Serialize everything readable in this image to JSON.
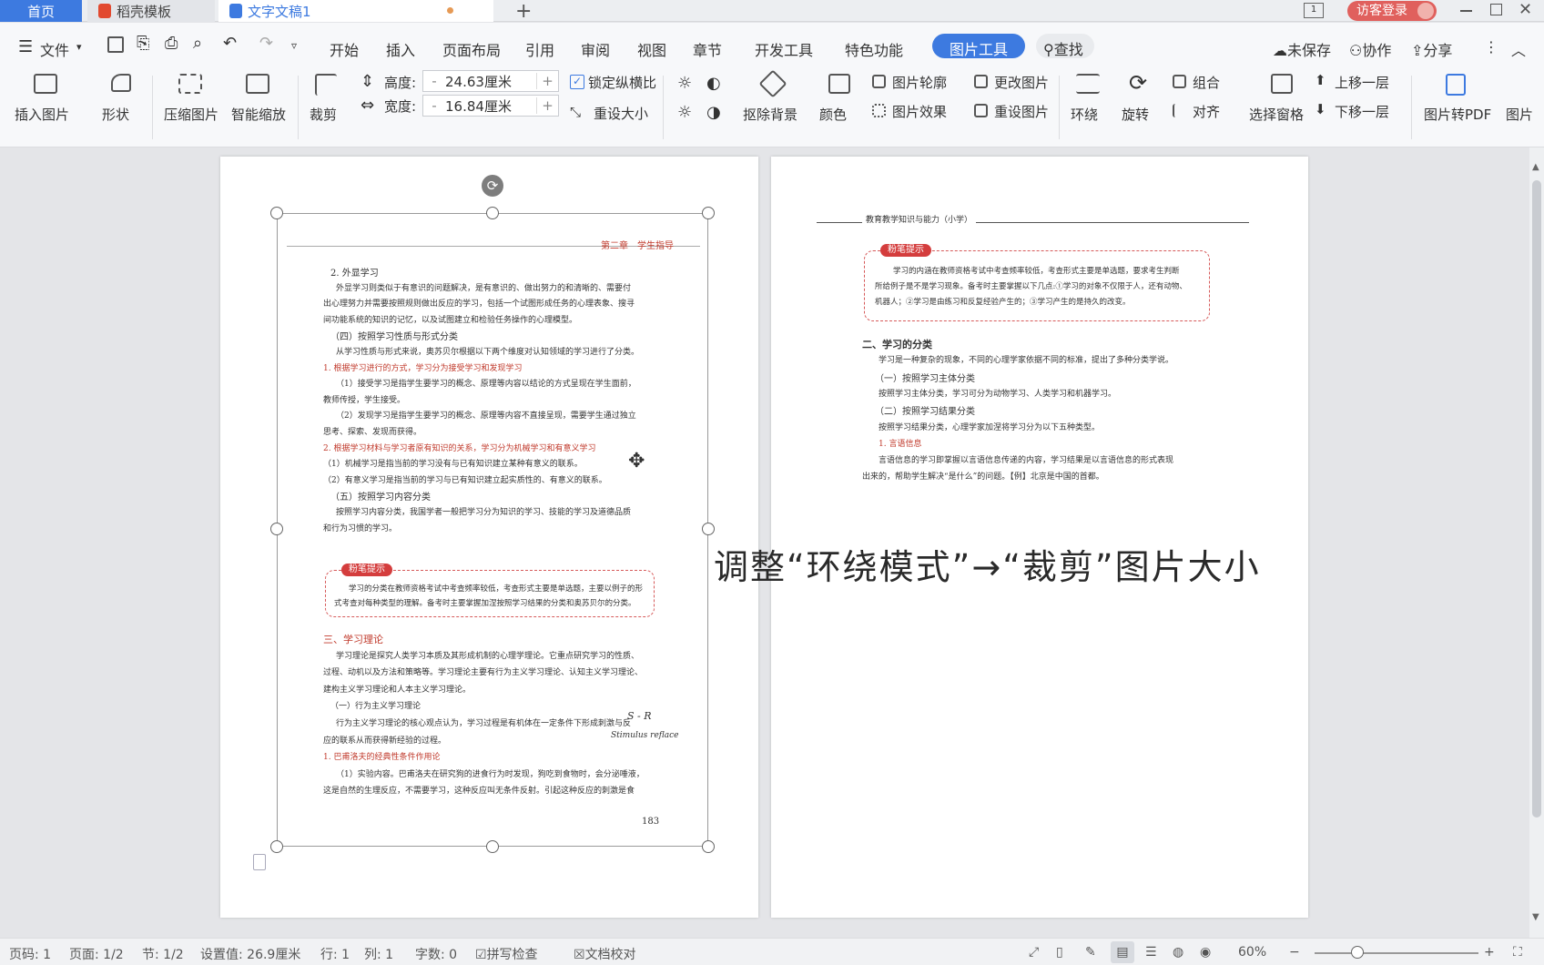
{
  "tabs": {
    "home": "首页",
    "template": "稻壳模板",
    "doc": "文字文稿1",
    "add": "+",
    "login": "访客登录"
  },
  "menu": {
    "file": "文件",
    "items": [
      "开始",
      "插入",
      "页面布局",
      "引用",
      "审阅",
      "视图",
      "章节",
      "开发工具",
      "特色功能",
      "图片工具"
    ],
    "search": "查找",
    "unsaved": "未保存",
    "collab": "协作",
    "share": "分享"
  },
  "ribbon": {
    "insert_image": "插入图片",
    "shape": "形状",
    "compress": "压缩图片",
    "smart_zoom": "智能缩放",
    "crop": "裁剪",
    "height_label": "高度:",
    "height_value": "24.63厘米",
    "width_label": "宽度:",
    "width_value": "16.84厘米",
    "lock_ratio": "锁定纵横比",
    "reset_size": "重设大小",
    "remove_bg": "抠除背景",
    "color": "颜色",
    "outline": "图片轮廓",
    "effect": "图片效果",
    "change_image": "更改图片",
    "reset_image": "重设图片",
    "wrap": "环绕",
    "rotate": "旋转",
    "group": "组合",
    "align": "对齐",
    "selection_pane": "选择窗格",
    "bring_forward": "上移一层",
    "send_backward": "下移一层",
    "to_pdf": "图片转PDF",
    "more": "图片"
  },
  "overlay_caption": "调整“环绕模式”→“裁剪”图片大小",
  "page1": {
    "chapter": "第二章　学生指导",
    "lines": [
      "2. 外显学习",
      "外显学习则类似于有意识的问题解决，是有意识的、做出努力的和清晰的、需要付",
      "出心理努力并需要按照规则做出反应的学习，包括一个试图形成任务的心理表象、搜寻",
      "间功能系统的知识的记忆，以及试图建立和检验任务操作的心理模型。",
      "（四）按照学习性质与形式分类",
      "从学习性质与形式来说，奥苏贝尔根据以下两个维度对认知领域的学习进行了分类。",
      "1. 根据学习进行的方式，学习分为接受学习和发现学习",
      "（1）接受学习是指学生要学习的概念、原理等内容以结论的方式呈现在学生面前，",
      "教师传授，学生接受。",
      "（2）发现学习是指学生要学习的概念、原理等内容不直接呈现，需要学生通过独立",
      "思考、探索、发现而获得。",
      "2. 根据学习材料与学习者原有知识的关系，学习分为机械学习和有意义学习",
      "（1）机械学习是指当前的学习没有与已有知识建立某种有意义的联系。",
      "（2）有意义学习是指当前的学习与已有知识建立起实质性的、有意义的联系。",
      "（五）按照学习内容分类",
      "按照学习内容分类，我国学者一般把学习分为知识的学习、技能的学习及道德品质",
      "和行为习惯的学习。"
    ],
    "tip_badge": "粉笔提示",
    "tip_lines": [
      "学习的分类在教师资格考试中考查频率较低，考查形式主要是单选题，主要以例子的形",
      "式考查对每种类型的理解。备考时主要掌握加涅按照学习结果的分类和奥苏贝尔的分类。"
    ],
    "lines2": [
      "三、学习理论",
      "学习理论是探究人类学习本质及其形成机制的心理学理论。它重点研究学习的性质、",
      "过程、动机以及方法和策略等。学习理论主要有行为主义学习理论、认知主义学习理论、",
      "建构主义学习理论和人本主义学习理论。",
      "（一）行为主义学习理论",
      "行为主义学习理论的核心观点认为，学习过程是有机体在一定条件下形成刺激与反",
      "应的联系从而获得新经验的过程。",
      "1. 巴甫洛夫的经典性条件作用论",
      "（1）实验内容。巴甫洛夫在研究狗的进食行为时发现，狗吃到食物时，会分泌唾液，",
      "这是自然的生理反应，不需要学习，这种反应叫无条件反射。引起这种反应的刺激是食"
    ],
    "page_number": "183",
    "handwriting": [
      "S - R",
      "Stimulus  reflace"
    ]
  },
  "page2": {
    "header": "教育教学知识与能力（小学）",
    "tip_badge": "粉笔提示",
    "tip_lines": [
      "学习的内涵在教师资格考试中考查频率较低，考查形式主要是单选题，要求考生判断",
      "所给例子是不是学习现象。备考时主要掌握以下几点:①学习的对象不仅限于人，还有动物、",
      "机器人；②学习是由练习和反复经验产生的；③学习产生的是持久的改变。"
    ],
    "lines": [
      "二、学习的分类",
      "学习是一种复杂的现象，不同的心理学家依据不同的标准，提出了多种分类学说。",
      "（一）按照学习主体分类",
      "按照学习主体分类，学习可分为动物学习、人类学习和机器学习。",
      "（二）按照学习结果分类",
      "按照学习结果分类，心理学家加涅将学习分为以下五种类型。",
      "1. 言语信息",
      "言语信息的学习即掌握以言语信息传递的内容，学习结果是以言语信息的形式表现",
      "出来的，帮助学生解决“是什么”的问题。【例】北京是中国的首都。"
    ]
  },
  "status": {
    "page_code": "页码: 1",
    "page": "页面: 1/2",
    "section": "节: 1/2",
    "setting": "设置值: 26.9厘米",
    "row": "行: 1",
    "col": "列: 1",
    "words": "字数: 0",
    "spell": "拼写检查",
    "proof": "文档校对",
    "zoom": "60%"
  },
  "colors": {
    "accent": "#3d7ae0",
    "tab_active": "#3d7ae0",
    "login": "#e0605d",
    "tip": "#d43d3d"
  }
}
